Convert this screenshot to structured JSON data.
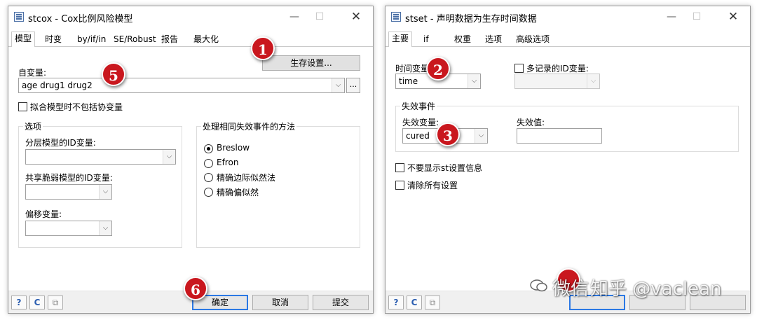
{
  "window_left": {
    "title": "stcox - Cox比例风险模型",
    "tabs": [
      "模型",
      "时变",
      "by/if/in",
      "SE/Robust",
      "报告",
      "最大化"
    ],
    "survival_settings_button": "生存设置...",
    "indepvars_label": "自变量:",
    "indepvars_value": "age  drug1 drug2",
    "dots_label": "...",
    "no_covariates_label": "拟合模型时不包括协变量",
    "options_group_title": "选项",
    "strata_id_label": "分层模型的ID变量:",
    "shared_frailty_label": "共享脆弱模型的ID变量:",
    "offset_label": "偏移变量:",
    "ties_group_title": "处理相同失效事件的方法",
    "ties_options": [
      "Breslow",
      "Efron",
      "精确边际似然法",
      "精确偏似然"
    ],
    "ties_selected": "Breslow",
    "footer": {
      "help": "?",
      "reset": "C",
      "copy": "⧉",
      "ok": "确定",
      "cancel": "取消",
      "submit": "提交"
    }
  },
  "window_right": {
    "title": "stset - 声明数据为生存时间数据",
    "tabs": [
      "主要",
      "if",
      "权重",
      "选项",
      "高级选项"
    ],
    "time_var_label": "时间变量:",
    "time_var_value": "time",
    "multi_record_label": "多记录的ID变量:",
    "failure_group_title": "失效事件",
    "failure_var_label": "失效变量:",
    "failure_var_value": "cured",
    "failure_value_label": "失效值:",
    "failure_value_value": "",
    "no_show_label": "不要显示st设置信息",
    "clear_all_label": "清除所有设置",
    "footer": {
      "help": "?",
      "reset": "C",
      "copy": "⧉"
    }
  },
  "badges": [
    "1",
    "5",
    "6",
    "2",
    "3"
  ],
  "watermark": {
    "text1": "微信",
    "text2": "知乎 @vaclean"
  },
  "colors": {
    "badge": "#c9171e",
    "default_button_border": "#2b78e4"
  }
}
